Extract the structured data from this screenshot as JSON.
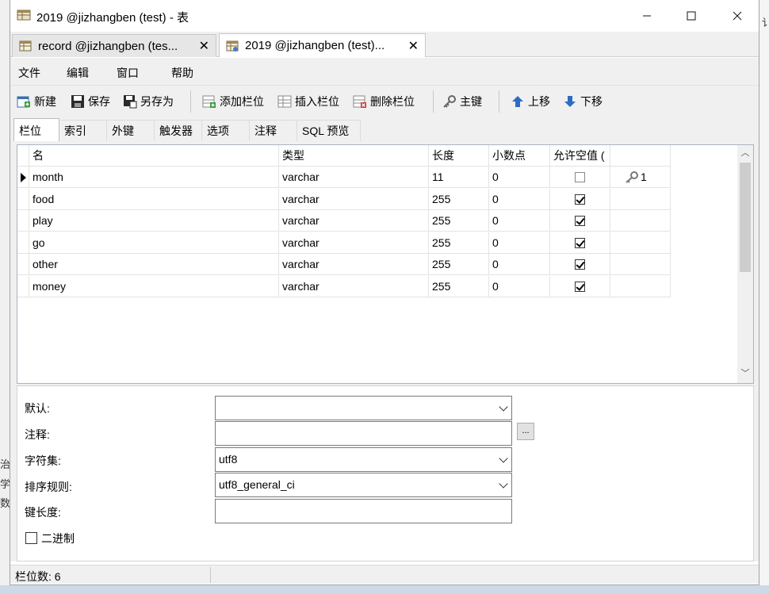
{
  "window": {
    "title": "2019 @jizhangben (test) - 表"
  },
  "doc_tabs": [
    {
      "label": "record @jizhangben (tes...",
      "close": "✕",
      "active": false
    },
    {
      "label": "2019 @jizhangben (test)...",
      "close": "✕",
      "active": true
    }
  ],
  "menu": [
    "文件",
    "编辑",
    "窗口",
    "帮助"
  ],
  "toolbar": {
    "new": "新建",
    "save": "保存",
    "save_as": "另存为",
    "add_field": "添加栏位",
    "insert_field": "插入栏位",
    "delete_field": "删除栏位",
    "primary_key": "主键",
    "move_up": "上移",
    "move_down": "下移"
  },
  "sub_tabs": [
    "栏位",
    "索引",
    "外键",
    "触发器",
    "选项",
    "注释",
    "SQL 预览"
  ],
  "grid": {
    "headers": {
      "name": "名",
      "type": "类型",
      "length": "长度",
      "decimals": "小数点",
      "allow_null": "允许空值 ("
    },
    "rows": [
      {
        "name": "month",
        "type": "varchar",
        "length": "11",
        "decimals": "0",
        "allow_null": false,
        "key": "1",
        "selected": true
      },
      {
        "name": "food",
        "type": "varchar",
        "length": "255",
        "decimals": "0",
        "allow_null": true,
        "key": "",
        "selected": false
      },
      {
        "name": "play",
        "type": "varchar",
        "length": "255",
        "decimals": "0",
        "allow_null": true,
        "key": "",
        "selected": false
      },
      {
        "name": "go",
        "type": "varchar",
        "length": "255",
        "decimals": "0",
        "allow_null": true,
        "key": "",
        "selected": false
      },
      {
        "name": "other",
        "type": "varchar",
        "length": "255",
        "decimals": "0",
        "allow_null": true,
        "key": "",
        "selected": false
      },
      {
        "name": "money",
        "type": "varchar",
        "length": "255",
        "decimals": "0",
        "allow_null": true,
        "key": "",
        "selected": false
      }
    ]
  },
  "props": {
    "default_label": "默认:",
    "default_value": "",
    "comment_label": "注释:",
    "comment_value": "",
    "ellipsis": "...",
    "charset_label": "字符集:",
    "charset_value": "utf8",
    "collation_label": "排序规则:",
    "collation_value": "utf8_general_ci",
    "key_length_label": "键长度:",
    "key_length_value": "",
    "binary_label": "二进制"
  },
  "status": {
    "field_count": "栏位数: 6"
  },
  "background": {
    "left_chars": [
      "治",
      "学",
      "数"
    ],
    "right_char": "讠"
  },
  "colors": {
    "accent_blue": "#2b6cc4",
    "window_bg": "#f0f0f0"
  }
}
